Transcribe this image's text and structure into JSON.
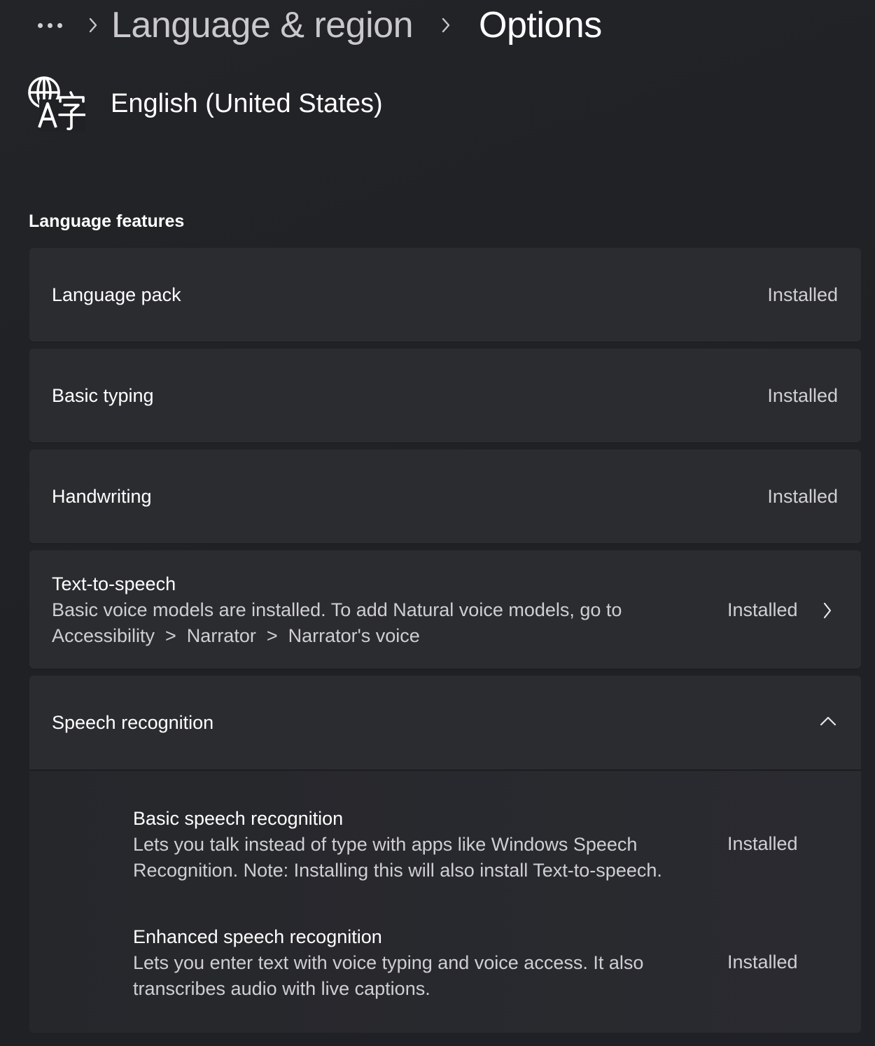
{
  "breadcrumb": {
    "more_label": "...",
    "items": [
      {
        "label": "Language & region"
      },
      {
        "label": "Options"
      }
    ]
  },
  "language": {
    "icon": "language-icon",
    "name": "English (United States)"
  },
  "section": {
    "title": "Language features"
  },
  "features": [
    {
      "title": "Language pack",
      "status": "Installed"
    },
    {
      "title": "Basic typing",
      "status": "Installed"
    },
    {
      "title": "Handwriting",
      "status": "Installed"
    },
    {
      "title": "Text-to-speech",
      "description_line1": "Basic voice models are installed. To add Natural voice models, go to",
      "description_line2": "Accessibility  >  Narrator  >  Narrator's voice",
      "status": "Installed",
      "icon": "chevron-right-icon"
    }
  ],
  "speech": {
    "title": "Speech recognition",
    "icon": "chevron-up-icon",
    "items": [
      {
        "title": "Basic speech recognition",
        "description_line1": "Lets you talk instead of type with apps like Windows Speech",
        "description_line2": "Recognition. Note: Installing this will also install Text-to-speech.",
        "status": "Installed"
      },
      {
        "title": "Enhanced speech recognition",
        "description_line1": "Lets you enter text with voice typing and voice access. It also",
        "description_line2": "transcribes audio with live captions.",
        "status": "Installed"
      }
    ]
  }
}
